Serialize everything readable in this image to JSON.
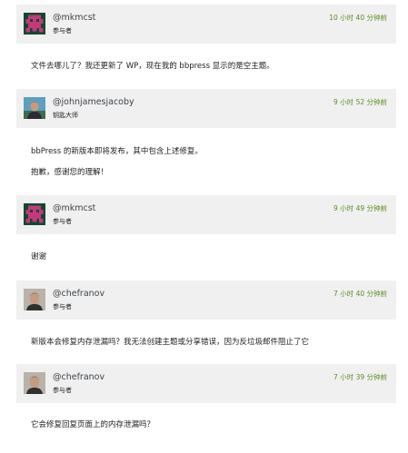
{
  "replies": [
    {
      "author": "@mkmcst",
      "role": "参与者",
      "time": "10 小时 40 分钟前",
      "avatar_icon": "pink-pixel-identicon",
      "paragraphs": [
        "文件去哪儿了？我还更新了 WP，现在我的 bbpress 显示的是空主题。"
      ]
    },
    {
      "author": "@johnjamesjacoby",
      "role": "钥匙大师",
      "time": "9 小时 52 分钟前",
      "avatar_icon": "user-photo-avatar",
      "paragraphs": [
        "bbPress 的新版本即将发布，其中包含上述修复。",
        "抱歉，感谢您的理解！"
      ]
    },
    {
      "author": "@mkmcst",
      "role": "参与者",
      "time": "9 小时 49 分钟前",
      "avatar_icon": "pink-pixel-identicon",
      "paragraphs": [
        "谢谢"
      ]
    },
    {
      "author": "@chefranov",
      "role": "参与者",
      "time": "7 小时 40 分钟前",
      "avatar_icon": "user-photo-avatar",
      "paragraphs": [
        "新版本会修复内存泄漏吗？我无法创建主题或分享错误，因为反垃圾邮件阻止了它"
      ]
    },
    {
      "author": "@chefranov",
      "role": "参与者",
      "time": "7 小时 39 分钟前",
      "avatar_icon": "user-photo-avatar",
      "paragraphs": [
        "它会修复回复页面上的内存泄漏吗？"
      ]
    }
  ],
  "colors": {
    "header_bg": "#f0f0f0",
    "timestamp": "#5a8f1f",
    "identicon": "#c6377d",
    "identicon_bg": "#0d4a2c"
  }
}
